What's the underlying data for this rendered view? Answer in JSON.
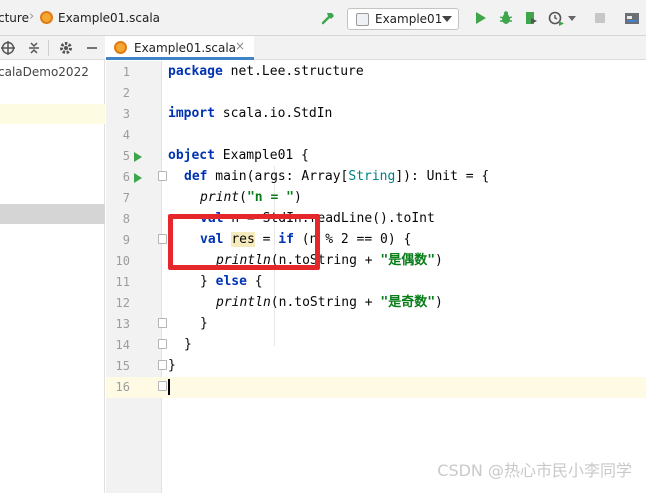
{
  "navbar": {
    "breadcrumb_prev": "cture",
    "breadcrumb_sep": "›",
    "breadcrumb_file": "Example01.scala",
    "run_config": "Example01"
  },
  "project_panel": {
    "tree_root": "calaDemo2022"
  },
  "tabs": [
    {
      "label": "Example01.scala",
      "close": "×"
    }
  ],
  "editor": {
    "line_numbers": [
      "1",
      "2",
      "3",
      "4",
      "5",
      "6",
      "7",
      "8",
      "9",
      "10",
      "11",
      "12",
      "13",
      "14",
      "15",
      "16"
    ],
    "lines": {
      "l1_kw": "package",
      "l1_rest": " net.Lee.structure",
      "l3_kw": "import",
      "l3_rest": " scala.io.StdIn",
      "l5_kw": "object",
      "l5_rest": " Example01 {",
      "l6_kw": "def",
      "l6_a": " main(args: Array[",
      "l6_type": "String",
      "l6_b": "]): Unit = {",
      "l7_fn": "print",
      "l7_a": "(",
      "l7_str": "\"n = \"",
      "l7_b": ")",
      "l8_kw": "val",
      "l8_rest": " n = StdIn.readLine().toInt",
      "l9_kw": "val",
      "l9_var": "res",
      "l9_a": " = ",
      "l9_kw2": "if",
      "l9_b": " (n % 2 == 0) {",
      "l10_fn": "println",
      "l10_a": "(n.toString + ",
      "l10_str": "\"是偶数\"",
      "l10_b": ")",
      "l11_a": "} ",
      "l11_kw": "else",
      "l11_b": " {",
      "l12_fn": "println",
      "l12_a": "(n.toString + ",
      "l12_str": "\"是奇数\"",
      "l12_b": ")",
      "l13": "}",
      "l14": "}",
      "l15": "}"
    }
  },
  "watermark": "CSDN @热心市民小李同学",
  "colors": {
    "keyword": "#0033b3",
    "string": "#067d17",
    "annotation_red": "#e5262a",
    "run_green": "#3ea54d",
    "tab_underline": "#4083c9"
  },
  "icons": [
    "hammer-icon",
    "run-icon",
    "debug-icon",
    "coverage-icon",
    "profile-icon",
    "stop-icon",
    "structure-icon",
    "locate-icon",
    "collapse-icon",
    "gear-icon",
    "hide-icon",
    "scala-file-icon"
  ]
}
